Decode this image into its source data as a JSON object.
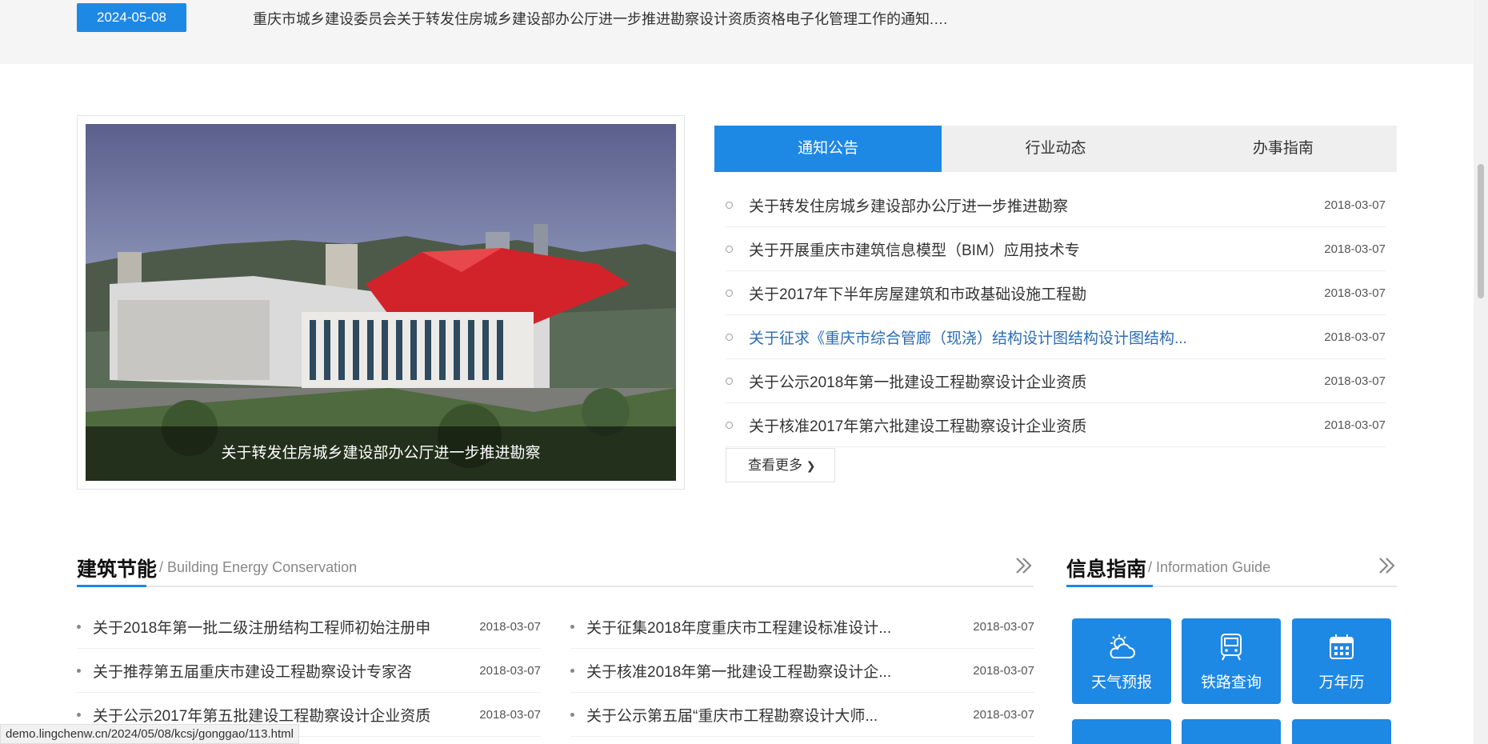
{
  "notice": {
    "date": "2024-05-08",
    "text": "重庆市城乡建设委员会关于转发住房城乡建设部办公厅进一步推进勘察设计资质资格电子化管理工作的通知.…"
  },
  "slide": {
    "caption": "关于转发住房城乡建设部办公厅进一步推进勘察"
  },
  "tabs": [
    {
      "label": "通知公告",
      "active": true
    },
    {
      "label": "行业动态",
      "active": false
    },
    {
      "label": "办事指南",
      "active": false
    }
  ],
  "news": [
    {
      "title": "关于转发住房城乡建设部办公厅进一步推进勘察",
      "date": "2018-03-07"
    },
    {
      "title": "关于开展重庆市建筑信息模型（BIM）应用技术专",
      "date": "2018-03-07"
    },
    {
      "title": "关于2017年下半年房屋建筑和市政基础设施工程勘",
      "date": "2018-03-07"
    },
    {
      "title": "关于征求《重庆市综合管廊（现浇）结构设计图结构设计图结构...",
      "date": "2018-03-07"
    },
    {
      "title": "关于公示2018年第一批建设工程勘察设计企业资质",
      "date": "2018-03-07"
    },
    {
      "title": "关于核准2017年第六批建设工程勘察设计企业资质",
      "date": "2018-03-07"
    }
  ],
  "more_label": "查看更多",
  "energy": {
    "title": "建筑节能",
    "subtitle": "/ Building Energy Conservation",
    "left": [
      {
        "title": "关于2018年第一批二级注册结构工程师初始注册申",
        "date": "2018-03-07"
      },
      {
        "title": "关于推荐第五届重庆市建设工程勘察设计专家咨",
        "date": "2018-03-07"
      },
      {
        "title": "关于公示2017年第五批建设工程勘察设计企业资质",
        "date": "2018-03-07"
      }
    ],
    "right": [
      {
        "title": "关于征集2018年度重庆市工程建设标准设计...",
        "date": "2018-03-07"
      },
      {
        "title": "关于核准2018年第一批建设工程勘察设计企...",
        "date": "2018-03-07"
      },
      {
        "title": "关于公示第五届“重庆市工程勘察设计大师...",
        "date": "2018-03-07"
      }
    ]
  },
  "guide": {
    "title": "信息指南",
    "subtitle": "/ Information Guide",
    "tiles": [
      {
        "label": "天气预报",
        "icon": "weather-icon"
      },
      {
        "label": "铁路查询",
        "icon": "train-icon"
      },
      {
        "label": "万年历",
        "icon": "calendar-icon"
      }
    ]
  },
  "status_url": "demo.lingchenw.cn/2024/05/08/kcsj/gonggao/113.html",
  "colors": {
    "accent": "#1e88e5",
    "highlight_link": "#2a6cb5"
  }
}
